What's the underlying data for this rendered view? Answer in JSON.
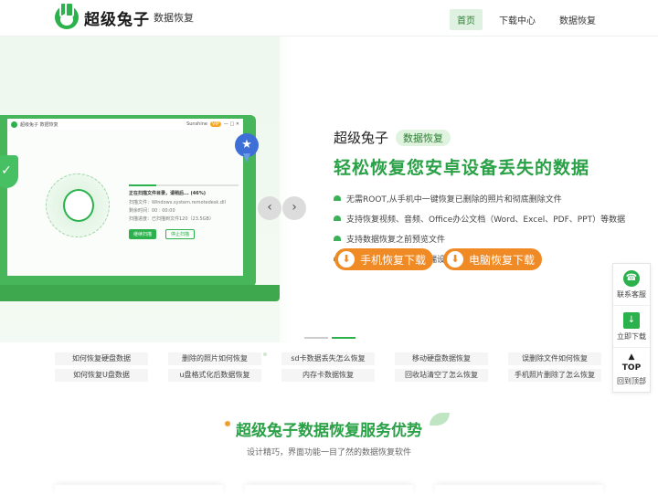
{
  "header": {
    "logo_title": "超级兔子",
    "logo_sub": "数据恢复",
    "nav": [
      "首页",
      "下载中心",
      "数据恢复"
    ]
  },
  "app_mock": {
    "title": "超级兔子 数据恢复",
    "user": "Sunshine",
    "badge": "VIP",
    "scan_title": "正在扫描文件目录，请稍后...",
    "percent": "(46%)",
    "line1": "扫描文件：Windows.system.remotedesk.dll",
    "line2": "剩余时间：00 : 00:00",
    "line3": "扫描进度：已扫描到文件120（23.5GB）",
    "btn_continue": "继续扫描",
    "btn_stop": "停止扫描"
  },
  "hero": {
    "title": "超级兔子",
    "tag": "数据恢复",
    "main": "轻松恢复您安卓设备丢失的数据",
    "features": [
      "无需ROOT,从手机中一键恢复已删除的照片和彻底删除文件",
      "支持恢复视频、音频、Office办公文档（Word、Excel、PDF、PPT）等数据",
      "支持数据恢复之前预览文件",
      "支持多种品牌安卓手机端设备"
    ],
    "btn_phone": "手机恢复下载",
    "btn_pc": "电脑恢复下载",
    "prev": "‹",
    "next": "›"
  },
  "links": [
    "如何恢复硬盘数据",
    "删除的照片如何恢复",
    "sd卡数据丢失怎么恢复",
    "移动硬盘数据恢复",
    "误删除文件如何恢复",
    "如何恢复U盘数据",
    "u盘格式化后数据恢复",
    "内存卡数据恢复",
    "回收站清空了怎么恢复",
    "手机照片删除了怎么恢复"
  ],
  "services": {
    "title": "超级兔子数据恢复服务优势",
    "subtitle": "设计精巧，界面功能一目了然的数据恢复软件"
  },
  "sidebar": {
    "service": "联系客服",
    "download": "立即下载",
    "top_label": "TOP",
    "top": "回到顶部"
  }
}
